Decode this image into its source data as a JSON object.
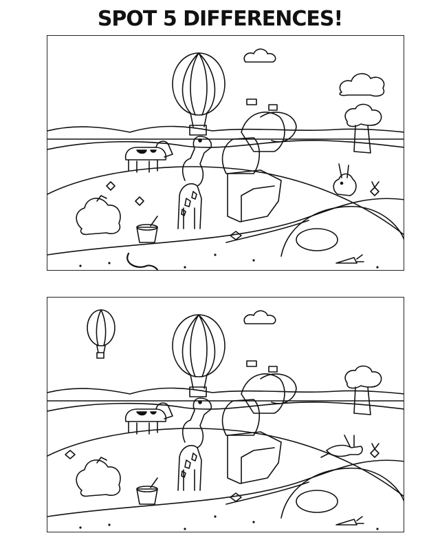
{
  "title": "SPOT 5 DIFFERENCES!",
  "colors": {
    "ink": "#111111",
    "paper": "#ffffff",
    "frame": "#222222"
  },
  "panels": [
    {
      "position": "top",
      "small_balloon_shown": false,
      "extra_cloud_shown": true,
      "worm_shown": true,
      "rabbit_pose": "sitting",
      "bush_flowers_count": 2
    },
    {
      "position": "bottom",
      "small_balloon_shown": true,
      "extra_cloud_shown": false,
      "worm_shown": false,
      "rabbit_pose": "leaping",
      "bush_flowers_count": 1
    }
  ]
}
